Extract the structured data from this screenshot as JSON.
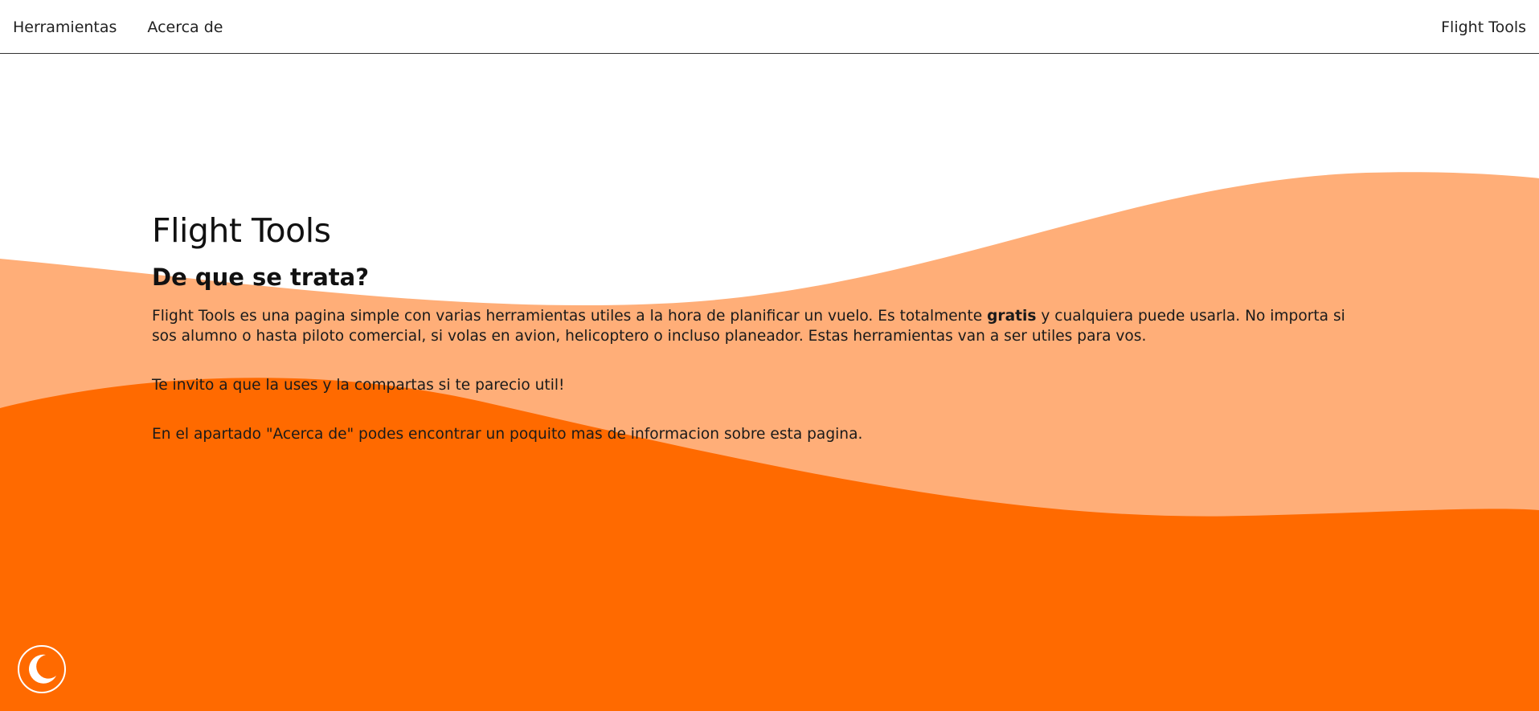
{
  "nav": {
    "links": [
      {
        "label": "Herramientas"
      },
      {
        "label": "Acerca de"
      }
    ],
    "brand": "Flight Tools"
  },
  "hero": {
    "title": "Flight Tools",
    "subtitle": "De que se trata?",
    "paragraph1_before": "Flight Tools es una pagina simple con varias herramientas utiles a la hora de planificar un vuelo. Es totalmente ",
    "paragraph1_bold": "gratis",
    "paragraph1_after": " y cualquiera puede usarla. No importa si sos alumno o hasta piloto comercial, si volas en avion, helicoptero o incluso planeador. Estas herramientas van a ser utiles para vos.",
    "paragraph2": "Te invito a que la uses y la compartas si te parecio util!",
    "paragraph3": "En el apartado \"Acerca de\" podes encontrar un poquito mas de informacion sobre esta pagina."
  },
  "theme_toggle": {
    "icon": "moon-icon"
  },
  "colors": {
    "wave_light": "#ffae78",
    "wave_dark": "#ff6a00",
    "background": "#ffffff",
    "text": "#111111"
  }
}
